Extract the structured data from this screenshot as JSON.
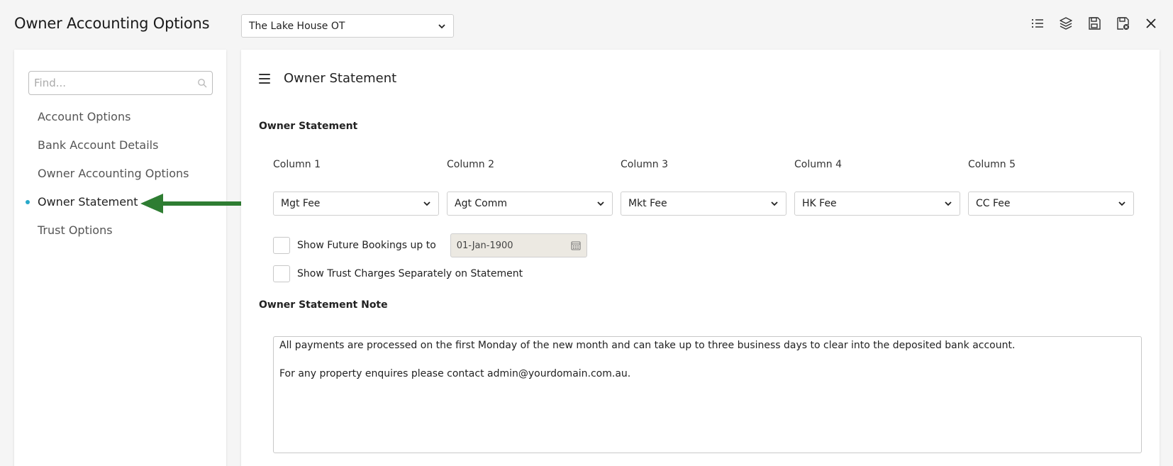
{
  "app": {
    "title": "Owner Accounting Options"
  },
  "property_select": {
    "value": "The Lake House OT"
  },
  "toolbar": {
    "icons": [
      "list-icon",
      "layers-icon",
      "save-icon",
      "save-close-icon",
      "close-icon"
    ]
  },
  "sidebar": {
    "search_placeholder": "Find...",
    "items": [
      {
        "label": "Account Options",
        "active": false
      },
      {
        "label": "Bank Account Details",
        "active": false
      },
      {
        "label": "Owner Accounting Options",
        "active": false
      },
      {
        "label": "Owner Statement",
        "active": true
      },
      {
        "label": "Trust Options",
        "active": false
      }
    ]
  },
  "main": {
    "title": "Owner Statement",
    "section_statement": "Owner Statement",
    "columns": [
      {
        "label": "Column 1",
        "value": "Mgt Fee"
      },
      {
        "label": "Column 2",
        "value": "Agt Comm"
      },
      {
        "label": "Column 3",
        "value": "Mkt Fee"
      },
      {
        "label": "Column 4",
        "value": "HK Fee"
      },
      {
        "label": "Column 5",
        "value": "CC Fee"
      }
    ],
    "future_bookings": {
      "label": "Show Future Bookings up to",
      "date": "01-Jan-1900",
      "checked": false
    },
    "trust_charges": {
      "label": "Show Trust Charges Separately on Statement",
      "checked": false
    },
    "section_note": "Owner Statement Note",
    "note_text": "All payments are processed on the first Monday of the new month and can take up to three business days to clear into the deposited bank account.\n\nFor any property enquires please contact admin@yourdomain.com.au."
  },
  "colors": {
    "accent_dot": "#27a9c9",
    "arrow": "#2e7d32"
  }
}
